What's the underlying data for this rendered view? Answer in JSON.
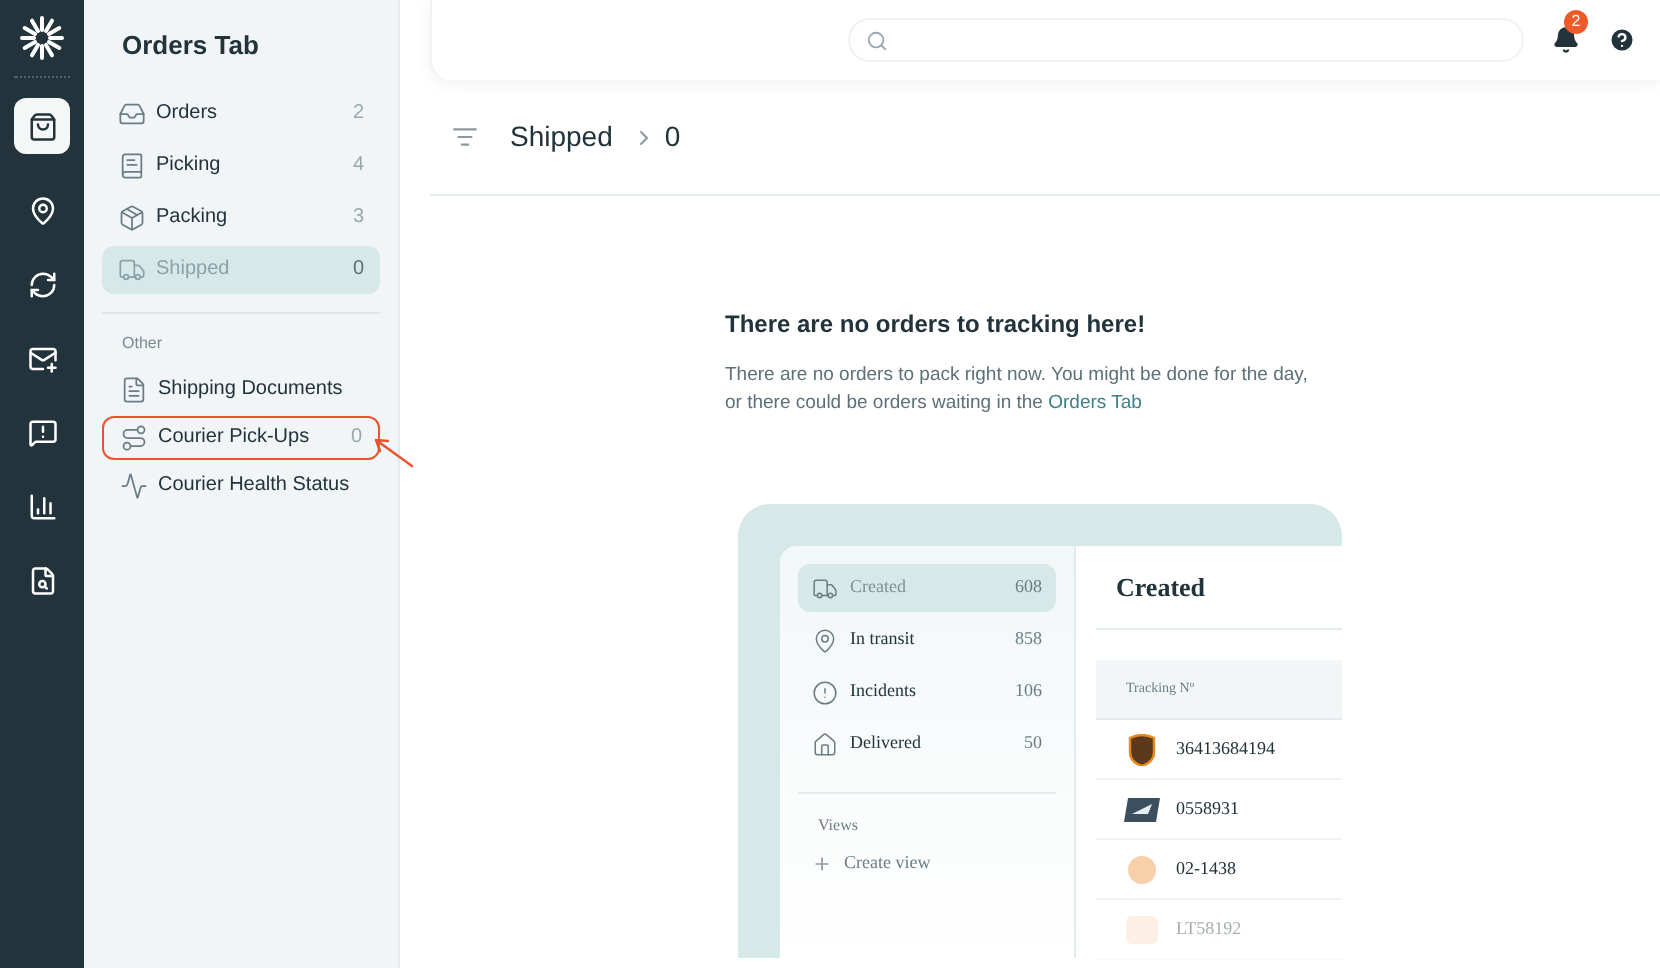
{
  "rail": {
    "items": [
      {
        "kind": "bag",
        "selected": true
      },
      {
        "kind": "pin",
        "selected": false
      },
      {
        "kind": "sync",
        "selected": false
      },
      {
        "kind": "mail",
        "selected": false
      },
      {
        "kind": "chat",
        "selected": false
      },
      {
        "kind": "chart",
        "selected": false
      },
      {
        "kind": "report",
        "selected": false
      }
    ]
  },
  "sidebar": {
    "title": "Orders Tab",
    "items": [
      {
        "kind": "inbox",
        "label": "Orders",
        "count": "2",
        "selected": false
      },
      {
        "kind": "list",
        "label": "Picking",
        "count": "4",
        "selected": false
      },
      {
        "kind": "box",
        "label": "Packing",
        "count": "3",
        "selected": false
      },
      {
        "kind": "truck",
        "label": "Shipped",
        "count": "0",
        "selected": true
      }
    ],
    "section_label": "Other",
    "other_items": [
      {
        "kind": "doc",
        "label": "Shipping Documents",
        "highlighted": false
      },
      {
        "kind": "route",
        "label": "Courier Pick-Ups",
        "count": "0",
        "highlighted": true
      },
      {
        "kind": "pulse",
        "label": "Courier Health Status",
        "highlighted": false
      }
    ]
  },
  "header": {
    "notification_count": "2"
  },
  "breadcrumb": {
    "title": "Shipped",
    "count": "0"
  },
  "empty_state": {
    "heading": "There are no orders to tracking here!",
    "body": "There are no orders to pack right now. You might be done for the day, or there could be orders waiting in the",
    "link": "Orders Tab"
  },
  "illustration": {
    "items": [
      {
        "kind": "truck",
        "label": "Created",
        "count": "608",
        "selected": true
      },
      {
        "kind": "pin",
        "label": "In transit",
        "count": "858",
        "selected": false
      },
      {
        "kind": "alert",
        "label": "Incidents",
        "count": "106",
        "selected": false
      },
      {
        "kind": "home",
        "label": "Delivered",
        "count": "50",
        "selected": false
      }
    ],
    "views_label": "Views",
    "create_view": "Create view",
    "panel_title": "Created",
    "column": "Tracking Nº",
    "rows": [
      {
        "kind": "shield",
        "number": "36413684194"
      },
      {
        "kind": "eagle",
        "number": "0558931"
      },
      {
        "kind": "circle",
        "number": "02-1438"
      },
      {
        "kind": "square",
        "number": "LT58192"
      }
    ]
  }
}
